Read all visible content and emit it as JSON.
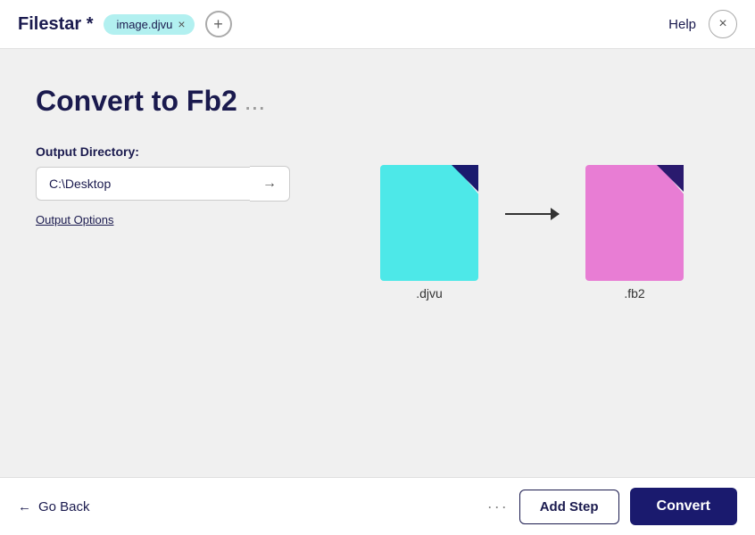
{
  "app": {
    "title": "Filestar *"
  },
  "header": {
    "file_tag": "image.djvu",
    "help_label": "Help",
    "close_symbol": "×",
    "add_symbol": "+"
  },
  "main": {
    "page_title": "Convert to Fb2",
    "page_title_dots": "...",
    "output_dir_label": "Output Directory:",
    "output_dir_value": "C:\\Desktop",
    "output_dir_arrow": "→",
    "output_options_label": "Output Options",
    "file_from_label": ".djvu",
    "file_to_label": ".fb2"
  },
  "footer": {
    "go_back_label": "Go Back",
    "go_back_arrow": "←",
    "more_options": "···",
    "add_step_label": "Add Step",
    "convert_label": "Convert"
  }
}
